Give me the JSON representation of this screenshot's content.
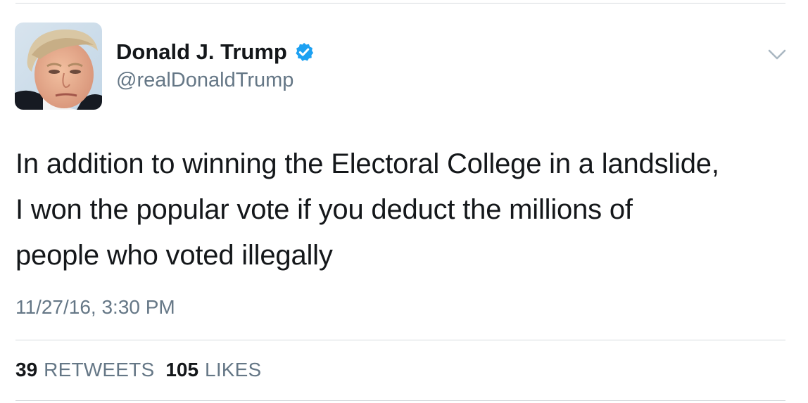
{
  "tweet": {
    "author": {
      "display_name": "Donald J. Trump",
      "handle": "@realDonaldTrump",
      "verified": true,
      "verified_color": "#1da1f2"
    },
    "text_lines": [
      "In addition to winning the Electoral College in a landslide,",
      "I won the popular vote if you deduct the millions of",
      "people who voted illegally"
    ],
    "timestamp": "11/27/16, 3:30 PM",
    "stats": {
      "retweets_count": "39",
      "retweets_label": "RETWEETS",
      "likes_count": "105",
      "likes_label": "LIKES"
    },
    "icons": {
      "avatar": "profile-photo",
      "verified": "verified-badge-icon",
      "more": "chevron-down-icon"
    }
  }
}
